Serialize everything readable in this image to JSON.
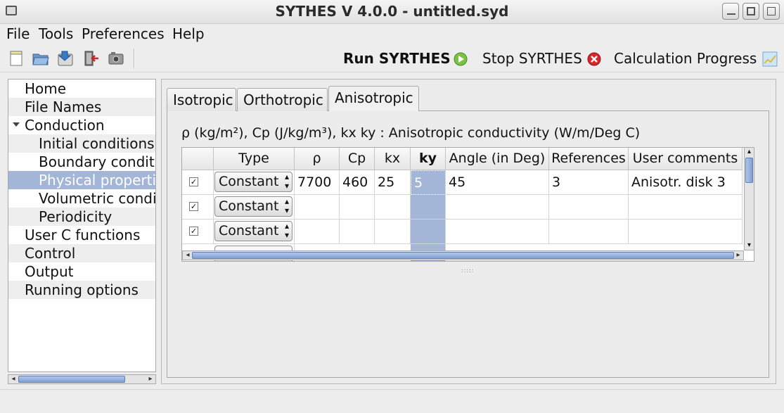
{
  "window": {
    "title": "SYTHES V 4.0.0 - untitled.syd"
  },
  "menu": [
    {
      "label": "File"
    },
    {
      "label": "Tools"
    },
    {
      "label": "Preferences"
    },
    {
      "label": "Help"
    }
  ],
  "toolbar": {
    "icons": [
      "new-file-icon",
      "open-folder-icon",
      "save-icon",
      "exit-icon",
      "screenshot-icon"
    ],
    "run_label": "Run SYRTHES",
    "stop_label": "Stop SYRTHES",
    "progress_label": "Calculation Progress"
  },
  "tree": [
    {
      "label": "Home"
    },
    {
      "label": "File Names"
    },
    {
      "label": "Conduction"
    },
    {
      "label": "Initial conditions"
    },
    {
      "label": "Boundary conditions"
    },
    {
      "label": "Physical properties"
    },
    {
      "label": "Volumetric conditions"
    },
    {
      "label": "Periodicity"
    },
    {
      "label": "User C functions"
    },
    {
      "label": "Control"
    },
    {
      "label": "Output"
    },
    {
      "label": "Running options"
    }
  ],
  "tabs": [
    {
      "label": "Isotropic"
    },
    {
      "label": "Orthotropic"
    },
    {
      "label": "Anisotropic"
    }
  ],
  "hint": "ρ (kg/m²), Cp (J/kg/m³), kx ky : Anisotropic conductivity (W/m/Deg C)",
  "table": {
    "headers": [
      "",
      "Type",
      "ρ",
      "Cp",
      "kx",
      "ky",
      "Angle (in Deg)",
      "References",
      "User comments"
    ],
    "rows": [
      {
        "checked": true,
        "type": "Constant",
        "rho": "7700",
        "cp": "460",
        "kx": "25",
        "ky": "5",
        "angle": "45",
        "refs": "3",
        "comment": "Anisotr. disk 3"
      },
      {
        "checked": true,
        "type": "Constant",
        "rho": "",
        "cp": "",
        "kx": "",
        "ky": "",
        "angle": "",
        "refs": "",
        "comment": ""
      },
      {
        "checked": true,
        "type": "Constant",
        "rho": "",
        "cp": "",
        "kx": "",
        "ky": "",
        "angle": "",
        "refs": "",
        "comment": ""
      }
    ]
  },
  "colors": {
    "selection": "#a4b6d7",
    "run_green": "#7cc242",
    "stop_red": "#d9262b"
  }
}
